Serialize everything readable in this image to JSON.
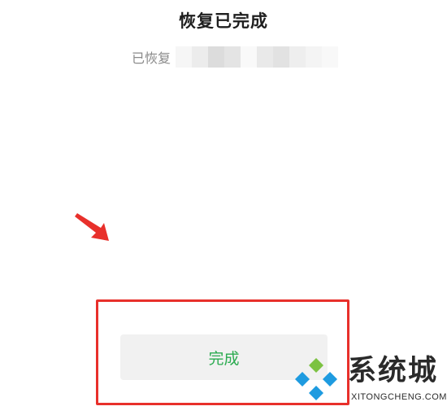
{
  "page": {
    "title": "恢复已完成",
    "subtitle": "已恢复"
  },
  "actions": {
    "done_label": "完成"
  },
  "annotation": {
    "arrow_color": "#e8302b",
    "box_color": "#e8302b"
  },
  "watermark": {
    "brand": "系统城",
    "domain": "XITONGCHENG.COM"
  },
  "colors": {
    "accent": "#2bab50",
    "button_bg": "#f1f1f1"
  }
}
